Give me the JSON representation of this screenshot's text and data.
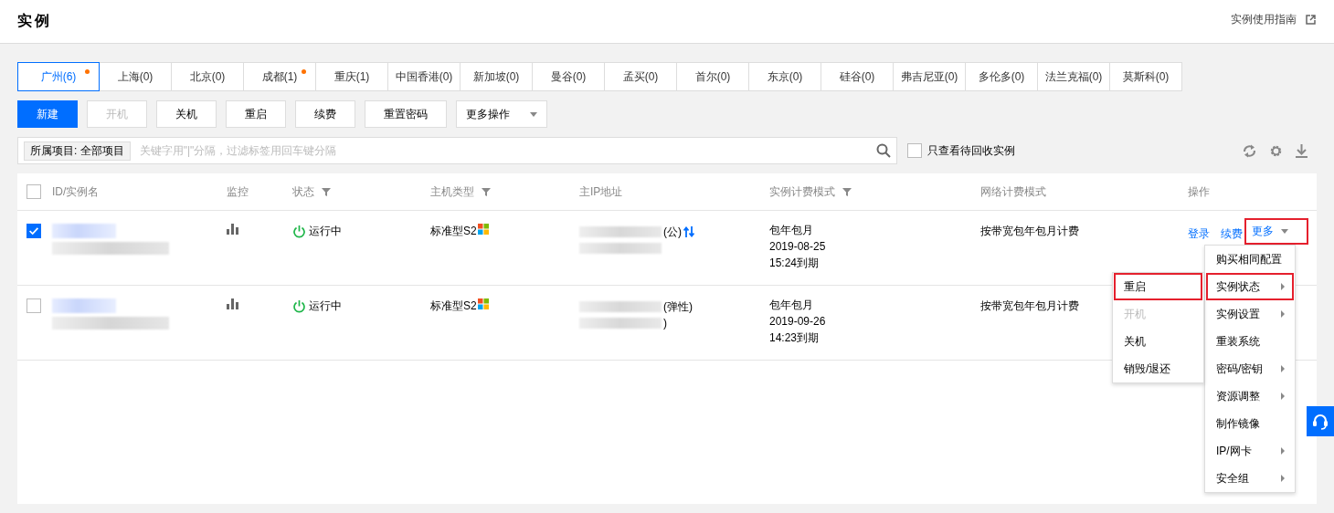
{
  "header": {
    "title": "实例",
    "guide_link": "实例使用指南"
  },
  "regions": [
    {
      "label": "广州(6)",
      "selected": true,
      "dot": true
    },
    {
      "label": "上海(0)",
      "selected": false,
      "dot": false
    },
    {
      "label": "北京(0)",
      "selected": false,
      "dot": false
    },
    {
      "label": "成都(1)",
      "selected": false,
      "dot": true
    },
    {
      "label": "重庆(1)",
      "selected": false,
      "dot": false
    },
    {
      "label": "中国香港(0)",
      "selected": false,
      "dot": false
    },
    {
      "label": "新加坡(0)",
      "selected": false,
      "dot": false
    },
    {
      "label": "曼谷(0)",
      "selected": false,
      "dot": false
    },
    {
      "label": "孟买(0)",
      "selected": false,
      "dot": false
    },
    {
      "label": "首尔(0)",
      "selected": false,
      "dot": false
    },
    {
      "label": "东京(0)",
      "selected": false,
      "dot": false
    },
    {
      "label": "硅谷(0)",
      "selected": false,
      "dot": false
    },
    {
      "label": "弗吉尼亚(0)",
      "selected": false,
      "dot": false
    },
    {
      "label": "多伦多(0)",
      "selected": false,
      "dot": false
    },
    {
      "label": "法兰克福(0)",
      "selected": false,
      "dot": false
    },
    {
      "label": "莫斯科(0)",
      "selected": false,
      "dot": false
    }
  ],
  "toolbar": {
    "buttons": [
      {
        "label": "新建",
        "kind": "primary",
        "disabled": false
      },
      {
        "label": "开机",
        "kind": "normal",
        "disabled": true
      },
      {
        "label": "关机",
        "kind": "normal",
        "disabled": false
      },
      {
        "label": "重启",
        "kind": "normal",
        "disabled": false
      },
      {
        "label": "续费",
        "kind": "normal",
        "disabled": false
      },
      {
        "label": "重置密码",
        "kind": "normal",
        "disabled": false
      }
    ],
    "dropdown": {
      "label": "更多操作"
    }
  },
  "search": {
    "tag": "所属项目: 全部项目",
    "placeholder": "关键字用\"|\"分隔，过滤标签用回车键分隔"
  },
  "recycle_filter": {
    "label": "只查看待回收实例",
    "checked": false
  },
  "table": {
    "all_checked": false,
    "columns": [
      {
        "label": "ID/实例名",
        "filter": false
      },
      {
        "label": "监控",
        "filter": false
      },
      {
        "label": "状态",
        "filter": true
      },
      {
        "label": "主机类型",
        "filter": true
      },
      {
        "label": "主IP地址",
        "filter": false
      },
      {
        "label": "实例计费模式",
        "filter": true
      },
      {
        "label": "网络计费模式",
        "filter": false
      },
      {
        "label": "操作",
        "filter": false
      }
    ],
    "rows": [
      {
        "selected": true,
        "status": "运行中",
        "host_type": "标准型S2",
        "ip_text": [
          "(公)"
        ],
        "ip_swap": true,
        "billing": [
          "包年包月",
          "2019-08-25",
          "15:24到期"
        ],
        "network": "按带宽包年包月计费",
        "actions": [
          {
            "label": "登录",
            "kind": "link"
          },
          {
            "label": "续费",
            "kind": "link"
          },
          {
            "label": "更多",
            "kind": "dropdown",
            "highlighted": true
          }
        ]
      },
      {
        "selected": false,
        "status": "运行中",
        "host_type": "标准型S2",
        "ip_text": [
          "(弹性)",
          ")"
        ],
        "ip_swap": false,
        "billing": [
          "包年包月",
          "2019-09-26",
          "14:23到期"
        ],
        "network": "按带宽包年包月计费"
      }
    ]
  },
  "more_menu": {
    "items": [
      {
        "label": "购买相同配置",
        "submenu": false,
        "highlighted": false
      },
      {
        "label": "实例状态",
        "submenu": true,
        "highlighted": true
      },
      {
        "label": "实例设置",
        "submenu": true,
        "highlighted": false
      },
      {
        "label": "重装系统",
        "submenu": false,
        "highlighted": false
      },
      {
        "label": "密码/密钥",
        "submenu": true,
        "highlighted": false
      },
      {
        "label": "资源调整",
        "submenu": true,
        "highlighted": false
      },
      {
        "label": "制作镜像",
        "submenu": false,
        "highlighted": false
      },
      {
        "label": "IP/网卡",
        "submenu": true,
        "highlighted": false
      },
      {
        "label": "安全组",
        "submenu": true,
        "highlighted": false
      }
    ]
  },
  "submenu": {
    "items": [
      {
        "label": "重启",
        "disabled": false,
        "highlighted": true
      },
      {
        "label": "开机",
        "disabled": true,
        "highlighted": false
      },
      {
        "label": "关机",
        "disabled": false,
        "highlighted": false
      },
      {
        "label": "销毁/退还",
        "disabled": false,
        "highlighted": false
      }
    ]
  }
}
